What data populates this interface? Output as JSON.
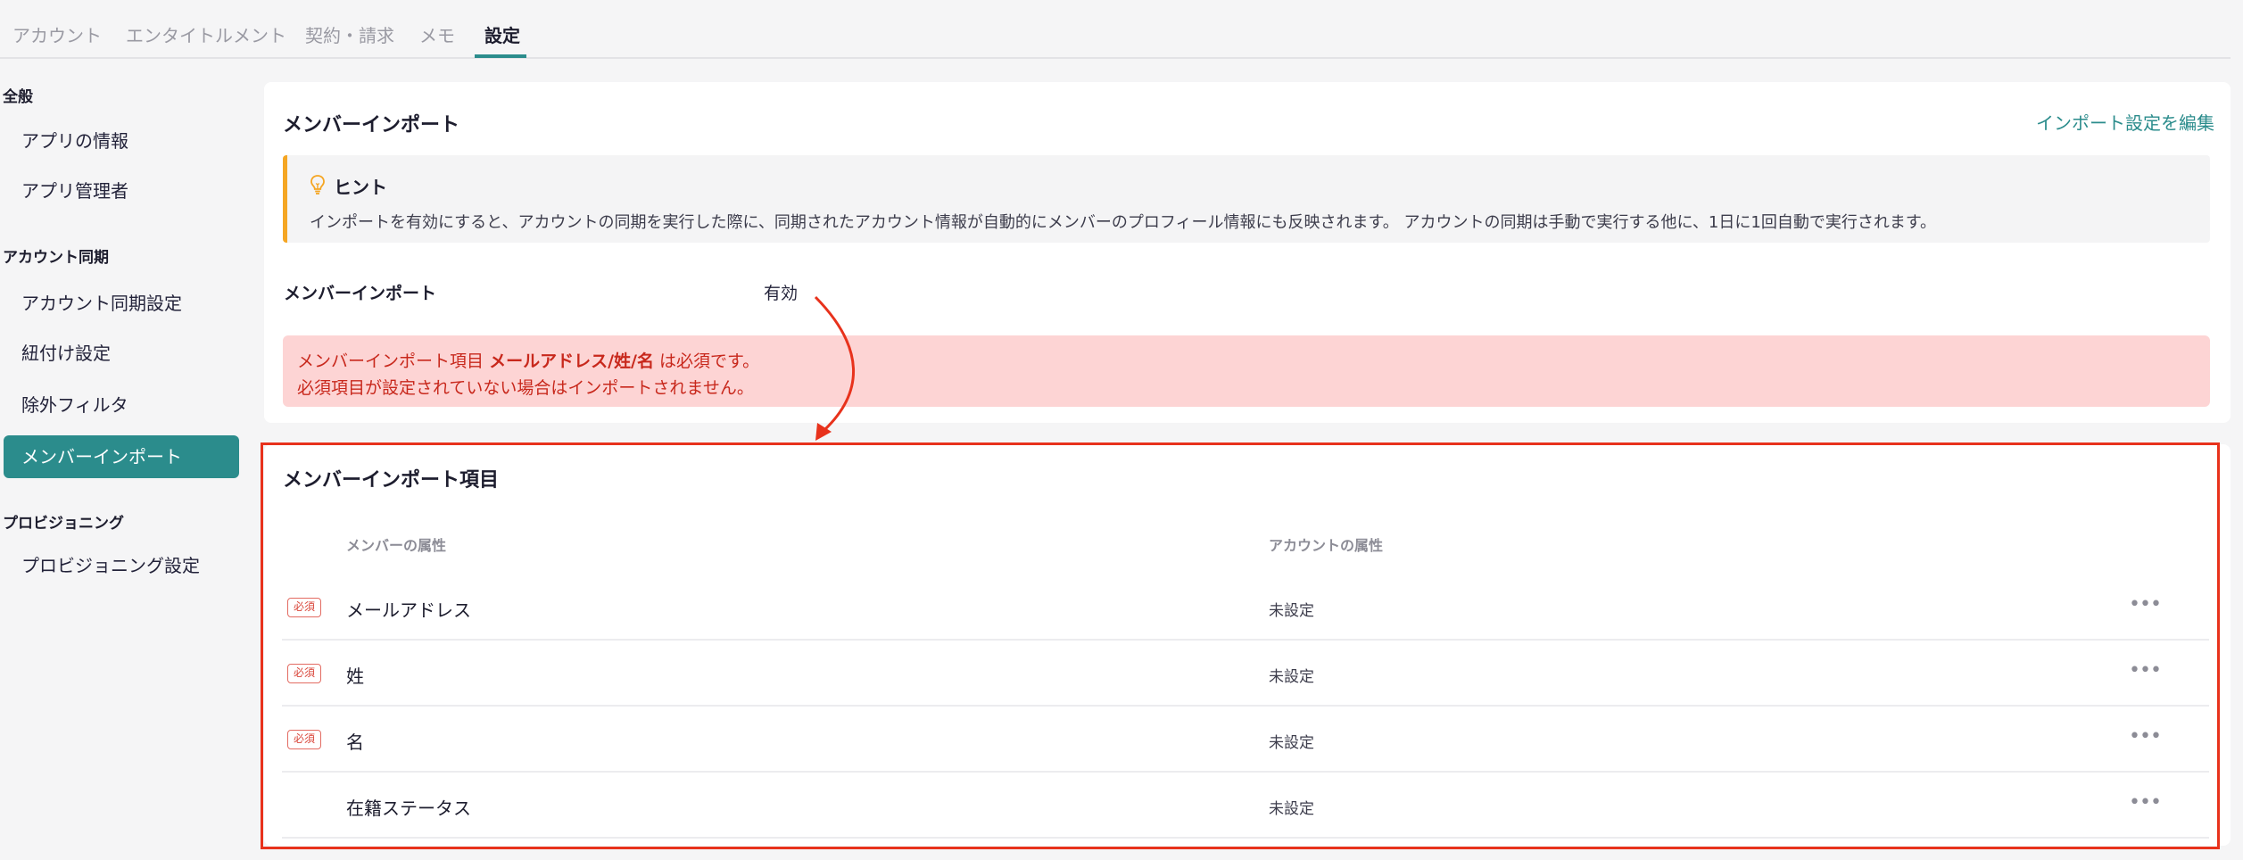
{
  "tabs": [
    {
      "label": "アカウント"
    },
    {
      "label": "エンタイトルメント"
    },
    {
      "label": "契約・請求"
    },
    {
      "label": "メモ"
    },
    {
      "label": "設定"
    }
  ],
  "sidebar": {
    "sections": [
      {
        "heading": "全般",
        "items": [
          "アプリの情報",
          "アプリ管理者"
        ]
      },
      {
        "heading": "アカウント同期",
        "items": [
          "アカウント同期設定",
          "紐付け設定",
          "除外フィルタ",
          "メンバーインポート"
        ]
      },
      {
        "heading": "プロビジョニング",
        "items": [
          "プロビジョニング設定"
        ]
      }
    ],
    "active_item": "メンバーインポート"
  },
  "member_import": {
    "title": "メンバーインポート",
    "edit_link": "インポート設定を編集",
    "hint": {
      "title": "ヒント",
      "text": "インポートを有効にすると、アカウントの同期を実行した際に、同期されたアカウント情報が自動的にメンバーのプロフィール情報にも反映されます。 アカウントの同期は手動で実行する他に、1日に1回自動で実行されます。"
    },
    "field_label": "メンバーインポート",
    "field_value": "有効",
    "error": {
      "line1_prefix": "メンバーインポート項目",
      "line1_strong": "メールアドレス/姓/名",
      "line1_suffix": "は必須です。",
      "line2": "必須項目が設定されていない場合はインポートされません。"
    }
  },
  "import_items": {
    "title": "メンバーインポート項目",
    "columns": {
      "member": "メンバーの属性",
      "account": "アカウントの属性"
    },
    "required_label": "必須",
    "more_label": "•••",
    "rows": [
      {
        "name": "メールアドレス",
        "account": "未設定",
        "required": true
      },
      {
        "name": "姓",
        "account": "未設定",
        "required": true
      },
      {
        "name": "名",
        "account": "未設定",
        "required": true
      },
      {
        "name": "在籍ステータス",
        "account": "未設定",
        "required": false
      }
    ]
  },
  "colors": {
    "accent": "#2b8c8c",
    "error_bg": "#fdd4d4",
    "error_text": "#c8281c",
    "highlight_outline": "#e8321c",
    "hint_bar": "#f5a623"
  }
}
